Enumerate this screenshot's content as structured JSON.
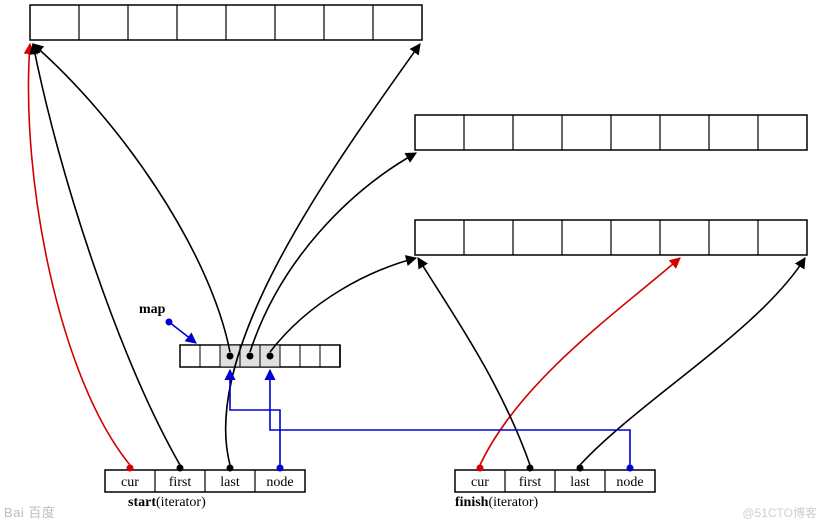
{
  "labels": {
    "map": "map",
    "start_prefix": "start",
    "start_paren": "(iterator)",
    "finish_prefix": "finish",
    "finish_paren": "(iterator)"
  },
  "iterator_fields": {
    "cur": "cur",
    "first": "first",
    "last": "last",
    "node": "node"
  },
  "buffers": {
    "buf1_cells": 8,
    "buf2_cells": 8,
    "buf3_cells": 8
  },
  "map_row": {
    "total_cells": 8,
    "filled_start": 2,
    "filled_count": 3
  },
  "colors": {
    "black": "#000000",
    "red": "#d40000",
    "blue": "#0000d4",
    "fill_gray": "#e0e0e0",
    "white": "#ffffff"
  },
  "watermarks": {
    "left": "Bai  百度",
    "right": "@51CTO博客"
  }
}
